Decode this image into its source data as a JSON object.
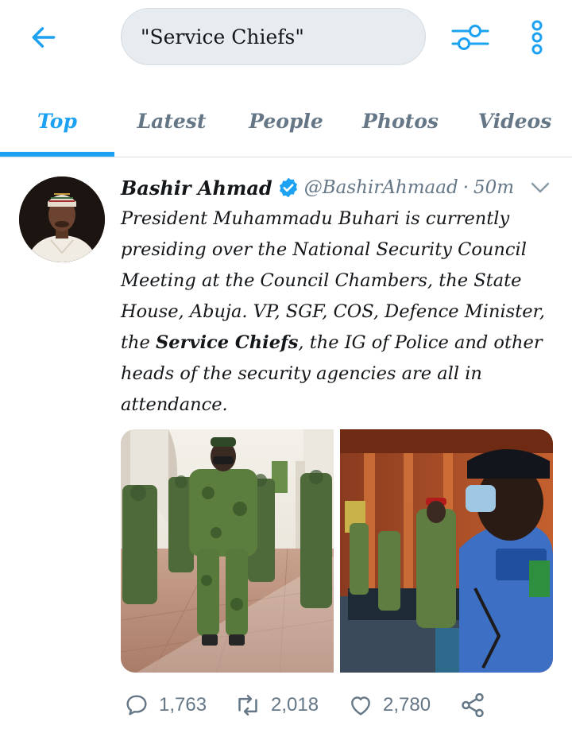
{
  "header": {
    "search_query": "\"Service Chiefs\"",
    "back_icon": "arrow-left-icon",
    "filter_icon": "sliders-icon",
    "more_icon": "more-vertical-icon"
  },
  "tabs": [
    {
      "label": "Top",
      "active": true
    },
    {
      "label": "Latest",
      "active": false
    },
    {
      "label": "People",
      "active": false
    },
    {
      "label": "Photos",
      "active": false
    },
    {
      "label": "Videos",
      "active": false
    }
  ],
  "tweet": {
    "display_name": "Bashir Ahmad",
    "handle": "@BashirAhmaad",
    "separator": "·",
    "time": "50m",
    "text_before": "President Muhammadu Buhari is currently presiding over the National Security Council Meeting at the Council Chambers, the State House, Abuja. VP, SGF, COS, Defence Minister, the ",
    "text_highlight": "Service Chiefs",
    "text_after": ", the IG of Police and other heads of the security agencies are all in attendance.",
    "replies": "1,763",
    "retweets": "2,018",
    "likes": "2,780"
  },
  "colors": {
    "accent": "#1da1f2",
    "muted": "#657786",
    "text": "#14171a"
  }
}
